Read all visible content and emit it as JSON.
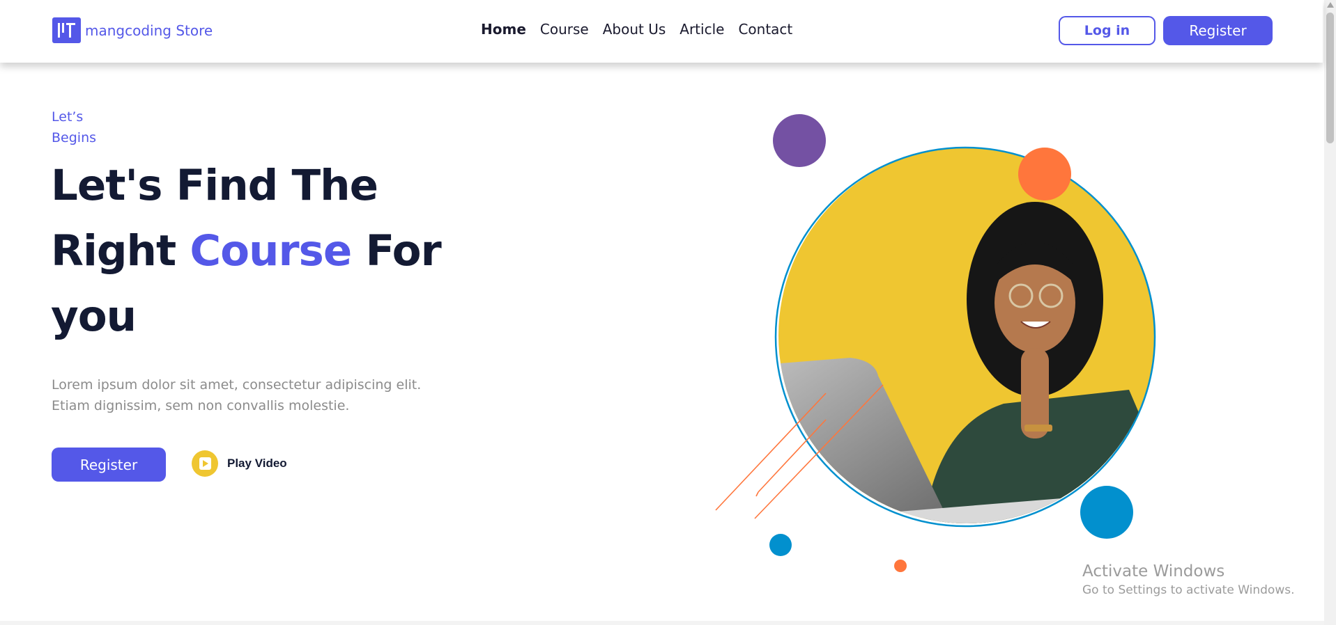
{
  "brand": {
    "name": "mangcoding Store",
    "logo_icon": "mangcoding-logo-icon"
  },
  "nav": {
    "items": [
      {
        "label": "Home",
        "active": true
      },
      {
        "label": "Course",
        "active": false
      },
      {
        "label": "About Us",
        "active": false
      },
      {
        "label": "Article",
        "active": false
      },
      {
        "label": "Contact",
        "active": false
      }
    ]
  },
  "auth": {
    "login_label": "Log in",
    "register_label": "Register"
  },
  "hero": {
    "eyebrow_line1": "Let’s",
    "eyebrow_line2": "Begins",
    "headline_part1": "Let's Find The Right ",
    "headline_accent": "Course",
    "headline_part2": " For you",
    "lead_line1": "Lorem ipsum dolor sit amet, consectetur adipiscing elit.",
    "lead_line2": "Etiam dignissim, sem non convallis molestie.",
    "register_label": "Register",
    "play_label": "Play Video",
    "play_icon": "play-icon"
  },
  "watermark": {
    "title": "Activate Windows",
    "subtitle": "Go to Settings to activate Windows."
  },
  "colors": {
    "accent": "#5458e8",
    "heading": "#131a33",
    "yellow": "#efc631",
    "orange": "#ff763c",
    "blue": "#0290ce",
    "purple": "#7451a3"
  }
}
